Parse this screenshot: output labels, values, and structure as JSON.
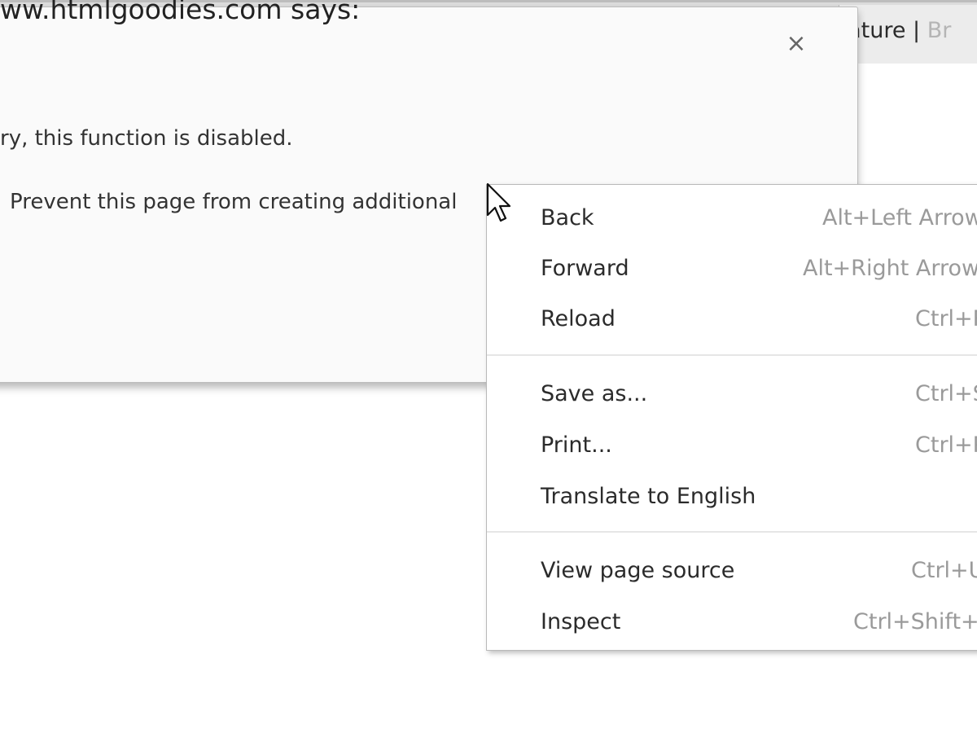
{
  "browser": {
    "tab_title_main": "rature | ",
    "tab_title_fade": "Br"
  },
  "dialog": {
    "title": "ww.htmlgoodies.com says:",
    "close_glyph": "×",
    "message": "ry, this function is disabled.",
    "checkbox_label": "Prevent this page from creating additional"
  },
  "context_menu": {
    "items": [
      {
        "label": "Back",
        "shortcut": "Alt+Left Arrow"
      },
      {
        "label": "Forward",
        "shortcut": "Alt+Right Arrow"
      },
      {
        "label": "Reload",
        "shortcut": "Ctrl+R"
      },
      {
        "label": "Save as...",
        "shortcut": "Ctrl+S"
      },
      {
        "label": "Print...",
        "shortcut": "Ctrl+P"
      },
      {
        "label": "Translate to English",
        "shortcut": ""
      },
      {
        "label": "View page source",
        "shortcut": "Ctrl+U"
      },
      {
        "label": "Inspect",
        "shortcut": "Ctrl+Shift+I"
      }
    ]
  },
  "cursor": {
    "icon": "arrow-cursor-icon"
  }
}
